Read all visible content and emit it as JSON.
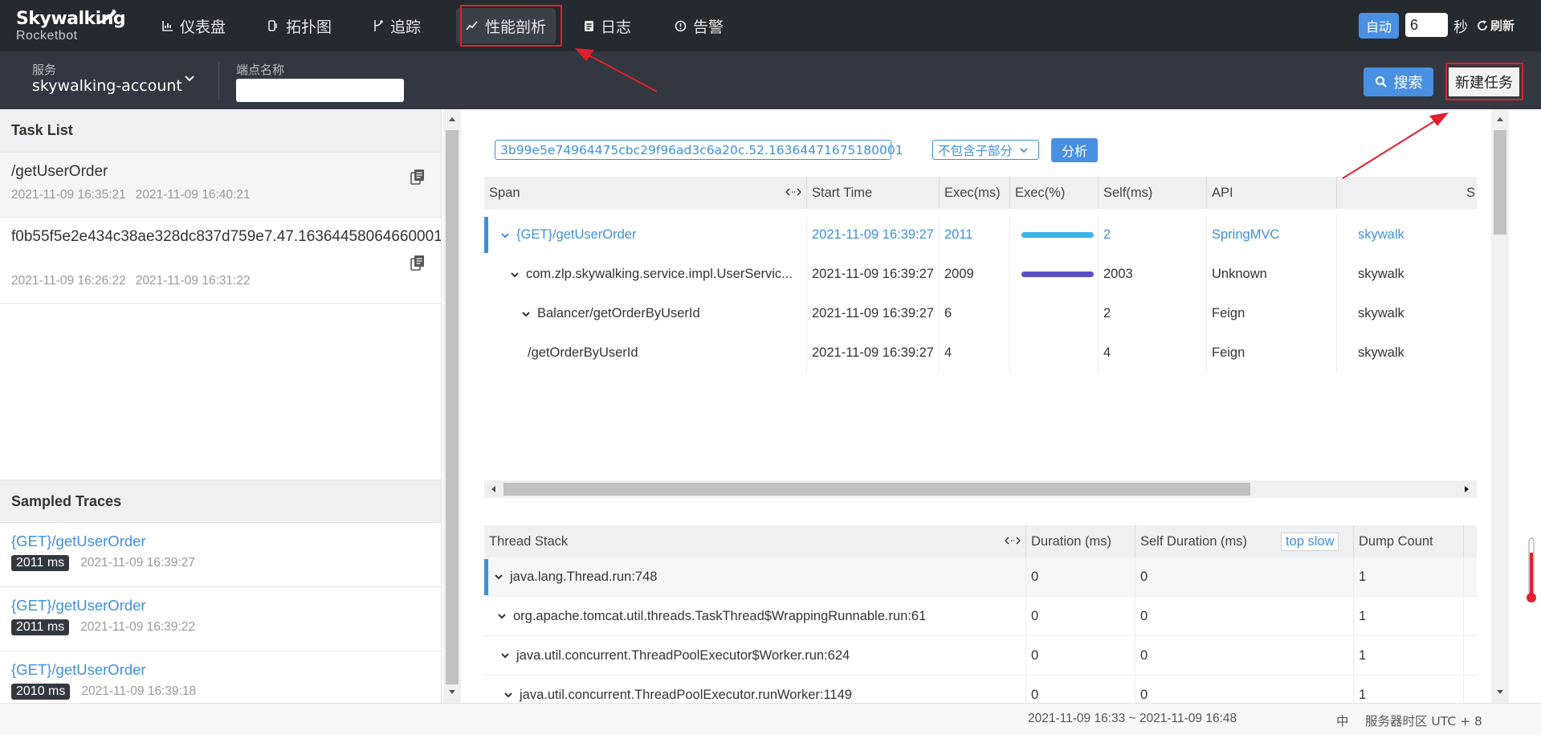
{
  "nav": {
    "logo_main": "Skywalking",
    "logo_sub": "Rocketbot",
    "items": [
      {
        "label": "仪表盘",
        "icon": "chart-icon"
      },
      {
        "label": "拓扑图",
        "icon": "topology-icon"
      },
      {
        "label": "追踪",
        "icon": "trace-icon"
      },
      {
        "label": "性能剖析",
        "icon": "profile-icon"
      },
      {
        "label": "日志",
        "icon": "log-icon"
      },
      {
        "label": "告警",
        "icon": "alarm-icon"
      }
    ],
    "auto_label": "自动",
    "interval_value": "6",
    "seconds_label": "秒",
    "refresh_label": "刷新"
  },
  "filter": {
    "service_label": "服务",
    "service_value": "skywalking-account",
    "endpoint_label": "端点名称",
    "endpoint_value": "",
    "search_label": "搜索",
    "new_task_label": "新建任务"
  },
  "tasks": {
    "header": "Task List",
    "items": [
      {
        "name": "/getUserOrder",
        "start": "2021-11-09 16:35:21",
        "end": "2021-11-09 16:40:21"
      },
      {
        "name": "f0b55f5e2e434c38ae328dc837d759e7.47.16364458064660001",
        "start": "2021-11-09 16:26:22",
        "end": "2021-11-09 16:31:22"
      }
    ]
  },
  "traces": {
    "header": "Sampled Traces",
    "items": [
      {
        "name": "{GET}/getUserOrder",
        "duration": "2011 ms",
        "time": "2021-11-09 16:39:27"
      },
      {
        "name": "{GET}/getUserOrder",
        "duration": "2011 ms",
        "time": "2021-11-09 16:39:22"
      },
      {
        "name": "{GET}/getUserOrder",
        "duration": "2010 ms",
        "time": "2021-11-09 16:39:18"
      }
    ]
  },
  "analysis": {
    "segment_id": "3b99e5e74964475cbc29f96ad3c6a20c.52.16364471675180001",
    "mode": "不包含子部分",
    "analyze_label": "分析"
  },
  "span_table": {
    "headers": [
      "Span",
      "Start Time",
      "Exec(ms)",
      "Exec(%)",
      "Self(ms)",
      "API",
      "S"
    ],
    "rows": [
      {
        "span": "{GET}/getUserOrder",
        "start": "2021-11-09 16:39:27",
        "exec": "2011",
        "pct": 1.0,
        "self": "2",
        "api": "SpringMVC",
        "svc": "skywalk",
        "bar_color": "#3bb4e6"
      },
      {
        "span": "com.zlp.skywalking.service.impl.UserServic...",
        "start": "2021-11-09 16:39:27",
        "exec": "2009",
        "pct": 0.999,
        "self": "2003",
        "api": "Unknown",
        "svc": "skywalk",
        "bar_color": "#5a4fc4"
      },
      {
        "span": "Balancer/getOrderByUserId",
        "start": "2021-11-09 16:39:27",
        "exec": "6",
        "pct": 0,
        "self": "2",
        "api": "Feign",
        "svc": "skywalk",
        "bar_color": "#3bb4e6"
      },
      {
        "span": "/getOrderByUserId",
        "start": "2021-11-09 16:39:27",
        "exec": "4",
        "pct": 0,
        "self": "4",
        "api": "Feign",
        "svc": "skywalk",
        "bar_color": "#3bb4e6"
      }
    ]
  },
  "stack_table": {
    "headers": [
      "Thread Stack",
      "Duration (ms)",
      "Self Duration (ms)",
      "Dump Count"
    ],
    "top_slow_label": "top slow",
    "rows": [
      {
        "stack": "java.lang.Thread.run:748",
        "duration": "0",
        "self": "0",
        "count": "1"
      },
      {
        "stack": "org.apache.tomcat.util.threads.TaskThread$WrappingRunnable.run:61",
        "duration": "0",
        "self": "0",
        "count": "1"
      },
      {
        "stack": "java.util.concurrent.ThreadPoolExecutor$Worker.run:624",
        "duration": "0",
        "self": "0",
        "count": "1"
      },
      {
        "stack": "java.util.concurrent.ThreadPoolExecutor.runWorker:1149",
        "duration": "0",
        "self": "0",
        "count": "1"
      }
    ]
  },
  "status": {
    "time_range": "2021-11-09 16:33 ~ 2021-11-09 16:48",
    "lang": "中",
    "timezone": "服务器时区 UTC + 8"
  }
}
